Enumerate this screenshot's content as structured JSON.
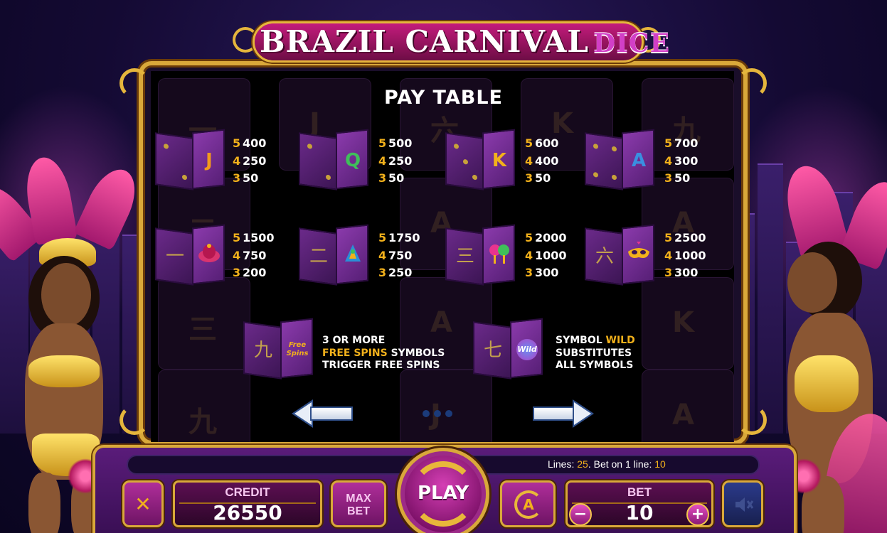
{
  "game": {
    "title_main": "BRAZIL CARNIVAL",
    "title_suffix": "DICE"
  },
  "paytable": {
    "title": "PAY TABLE",
    "rows": [
      [
        {
          "symbol": "J",
          "symbol_color": "#f29a1c",
          "pays": [
            {
              "count": "5",
              "value": "400"
            },
            {
              "count": "4",
              "value": "250"
            },
            {
              "count": "3",
              "value": "50"
            }
          ]
        },
        {
          "symbol": "Q",
          "symbol_color": "#3fbf5a",
          "pays": [
            {
              "count": "5",
              "value": "500"
            },
            {
              "count": "4",
              "value": "250"
            },
            {
              "count": "3",
              "value": "50"
            }
          ]
        },
        {
          "symbol": "K",
          "symbol_color": "#f2b11b",
          "pays": [
            {
              "count": "5",
              "value": "600"
            },
            {
              "count": "4",
              "value": "400"
            },
            {
              "count": "3",
              "value": "50"
            }
          ]
        },
        {
          "symbol": "A",
          "symbol_color": "#3a8fe0",
          "pays": [
            {
              "count": "5",
              "value": "700"
            },
            {
              "count": "4",
              "value": "300"
            },
            {
              "count": "3",
              "value": "50"
            }
          ]
        }
      ],
      [
        {
          "glyph": "一",
          "icon": "carnival-hat-icon",
          "pays": [
            {
              "count": "5",
              "value": "1500"
            },
            {
              "count": "4",
              "value": "750"
            },
            {
              "count": "3",
              "value": "200"
            }
          ]
        },
        {
          "glyph": "二",
          "icon": "parrot-icon",
          "pays": [
            {
              "count": "5",
              "value": "1750"
            },
            {
              "count": "4",
              "value": "750"
            },
            {
              "count": "3",
              "value": "250"
            }
          ]
        },
        {
          "glyph": "三",
          "icon": "maracas-icon",
          "pays": [
            {
              "count": "5",
              "value": "2000"
            },
            {
              "count": "4",
              "value": "1000"
            },
            {
              "count": "3",
              "value": "300"
            }
          ]
        },
        {
          "glyph": "六",
          "icon": "carnival-mask-icon",
          "pays": [
            {
              "count": "5",
              "value": "2500"
            },
            {
              "count": "4",
              "value": "1000"
            },
            {
              "count": "3",
              "value": "300"
            }
          ]
        }
      ]
    ],
    "specials": [
      {
        "glyph": "九",
        "badge": "Free Spins",
        "line1": "3 OR MORE",
        "line2_hl": "FREE SPINS",
        "line2_rest": " SYMBOLS",
        "line3": "TRIGGER FREE SPINS"
      },
      {
        "glyph": "七",
        "badge": "Wild",
        "line1_pre": "SYMBOL ",
        "line1_hl": "WILD",
        "line2": "SUBSTITUTES",
        "line3": "ALL SYMBOLS"
      }
    ],
    "page_count": 3
  },
  "status": {
    "lines_label": "Lines: ",
    "lines_value": "25",
    "bet_line_label": ". Bet on 1 line: ",
    "bet_line_value": "10"
  },
  "controls": {
    "close_label": "✕",
    "credit_label": "CREDIT",
    "credit_value": "26550",
    "max_bet_line1": "MAX",
    "max_bet_line2": "BET",
    "play_label": "PLAY",
    "autoplay_label": "A",
    "bet_label": "BET",
    "bet_value": "10",
    "minus_label": "−",
    "plus_label": "+"
  },
  "colors": {
    "accent_gold": "#f2b11b",
    "frame_gold": "#d9a83a",
    "panel_bg": "#000000",
    "bar_purple": "#5a1c7a"
  }
}
